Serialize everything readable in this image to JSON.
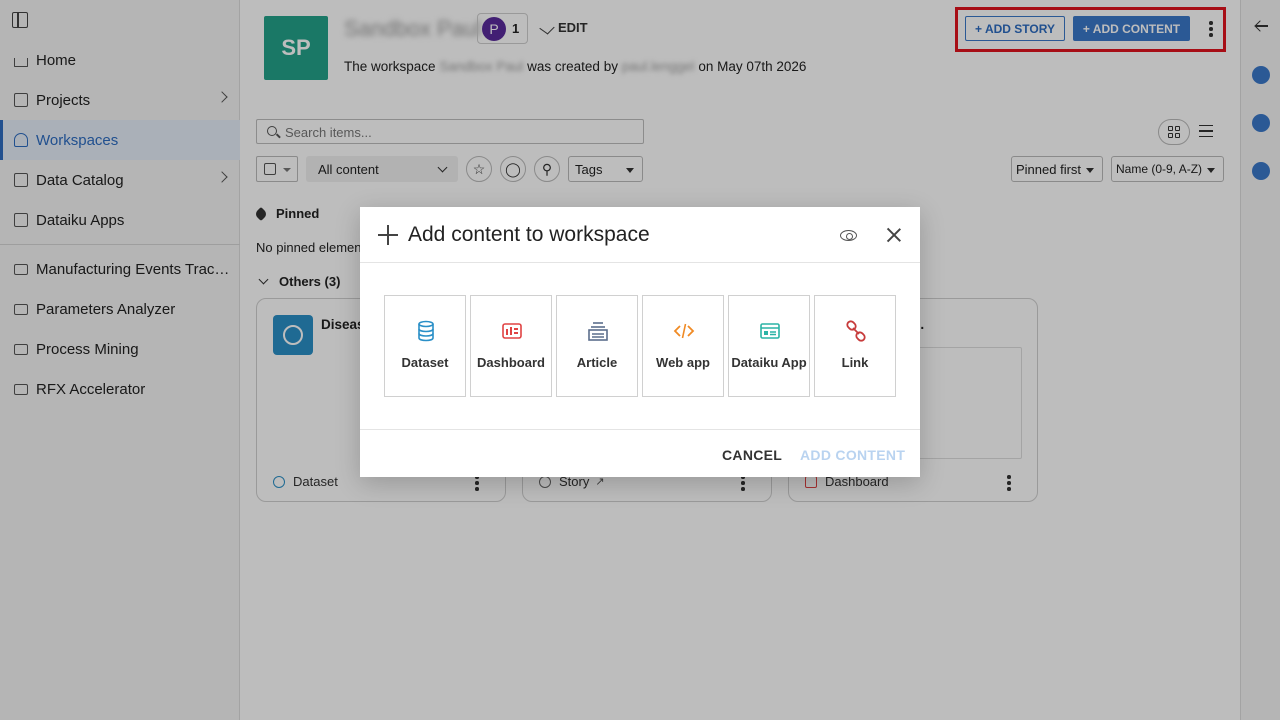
{
  "sidebar": {
    "items": [
      {
        "label": "Home",
        "icon": "home-icon"
      },
      {
        "label": "Projects",
        "icon": "projects-icon"
      },
      {
        "label": "Workspaces",
        "icon": "workspaces-icon"
      },
      {
        "label": "Data Catalog",
        "icon": "catalog-icon"
      },
      {
        "label": "Dataiku Apps",
        "icon": "apps-icon"
      }
    ],
    "workspaces_list": [
      {
        "label": "Manufacturing Events Trac…"
      },
      {
        "label": "Parameters Analyzer"
      },
      {
        "label": "Process Mining"
      },
      {
        "label": "RFX Accelerator"
      }
    ]
  },
  "header": {
    "avatar_initials": "SP",
    "workspace_name": "Sandbox Paul",
    "member_initial": "P",
    "member_count": "1",
    "edit_label": "EDIT",
    "desc_prefix": "The workspace",
    "desc_name": "Sandbox Paul",
    "desc_mid": "was created by",
    "desc_user": "paul.lenggel",
    "desc_suffix": "on May 07th 2026",
    "add_story_label": "+ ADD STORY",
    "add_content_label": "+ ADD CONTENT"
  },
  "search": {
    "placeholder": "Search items..."
  },
  "filters": {
    "content_select": "All content",
    "tags_select": "Tags",
    "sort_pinned": "Pinned first",
    "sort_name": "Name (0-9, A-Z)"
  },
  "sections": {
    "pinned_title": "Pinned",
    "no_pinned_text": "No pinned element",
    "others_title": "Others (3)"
  },
  "cards": [
    {
      "title": "Diseas",
      "type_label": "Dataset"
    },
    {
      "title": "",
      "type_label": "Story"
    },
    {
      "title": "t …",
      "type_label": "Dashboard"
    }
  ],
  "modal": {
    "title": "Add content to workspace",
    "content_types": [
      {
        "label": "Dataset",
        "icon": "database-icon",
        "color": "#2a8fc7"
      },
      {
        "label": "Dashboard",
        "icon": "dashboard-icon",
        "color": "#e04343"
      },
      {
        "label": "Article",
        "icon": "article-icon",
        "color": "#5b6e8c"
      },
      {
        "label": "Web app",
        "icon": "code-icon",
        "color": "#f08a24"
      },
      {
        "label": "Dataiku App",
        "icon": "app-icon",
        "color": "#2ab3a5"
      },
      {
        "label": "Link",
        "icon": "link-icon",
        "color": "#c73b3b"
      }
    ],
    "cancel_label": "CANCEL",
    "add_label": "ADD CONTENT"
  },
  "colors": {
    "accent": "#3b78c9",
    "avatar_bg": "#24a38a",
    "highlight": "#e2131e"
  }
}
